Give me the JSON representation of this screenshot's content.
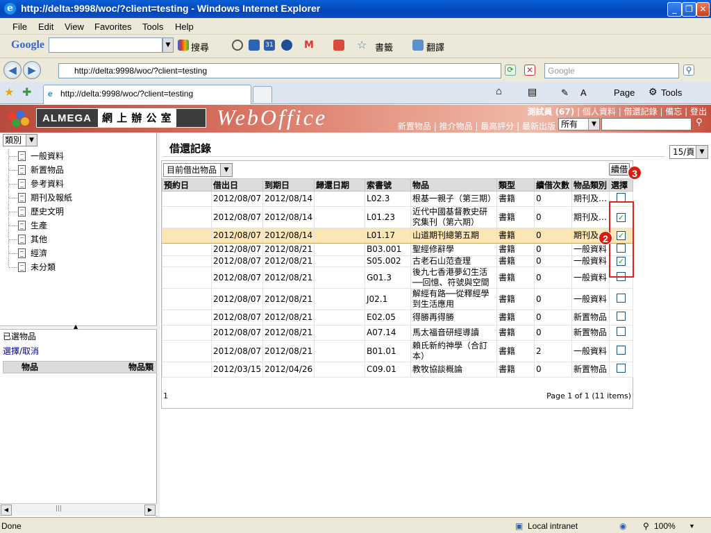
{
  "window": {
    "title": "http://delta:9998/woc/?client=testing - Windows Internet Explorer"
  },
  "menu": [
    "File",
    "Edit",
    "View",
    "Favorites",
    "Tools",
    "Help"
  ],
  "google_toolbar": {
    "brand": "Google",
    "search_label": "搜尋",
    "bookmarks_label": "書籤",
    "translate_label": "翻譯"
  },
  "address": {
    "url": "http://delta:9998/woc/?client=testing",
    "search_placeholder": "Google"
  },
  "tab": {
    "title": "http://delta:9998/woc/?client=testing"
  },
  "commandbar": {
    "page_label": "Page",
    "tools_label": "Tools"
  },
  "header": {
    "brand": "ALMEGA",
    "brand_cn": "網 上 辦 公 室",
    "logo": "WebOffice",
    "user": "測試員 (67)",
    "links_top": [
      "個人資料",
      "借還記錄",
      "備忘",
      "登出"
    ],
    "links_bottom": [
      "新置物品",
      "推介物品",
      "最高評分",
      "最新出版"
    ],
    "filter_value": "所有"
  },
  "sidebar": {
    "category_select": "類別",
    "tree": [
      "一般資料",
      "新置物品",
      "參考資料",
      "期刊及報紙",
      "歷史文明",
      "生產",
      "其他",
      "經濟",
      "未分類"
    ],
    "selected_title": "已選物品",
    "select_toggle": "選擇/取消",
    "selected_columns": [
      "物品",
      "物品類"
    ]
  },
  "main": {
    "title": "借還記錄",
    "per_page": "15/頁",
    "filter": "目前借出物品",
    "renew_button": "續借",
    "columns": [
      "預約日",
      "借出日",
      "到期日",
      "歸還日期",
      "索書號",
      "物品",
      "類型",
      "續借次數",
      "物品類別",
      "選擇"
    ],
    "rows": [
      {
        "reserve": "",
        "out": "2012/08/07",
        "due": "2012/08/14",
        "returned": "",
        "call": "L02.3",
        "item": "根基一親子（第三期）",
        "type": "書籍",
        "renew": "0",
        "category": "期刊及…",
        "checked": false
      },
      {
        "reserve": "",
        "out": "2012/08/07",
        "due": "2012/08/14",
        "returned": "",
        "call": "L01.23",
        "item": "近代中國基督教史研究集刊（第六期）",
        "type": "書籍",
        "renew": "0",
        "category": "期刊及…",
        "checked": true
      },
      {
        "reserve": "",
        "out": "2012/08/07",
        "due": "2012/08/14",
        "returned": "",
        "call": "L01.17",
        "item": "山道期刊總第五期",
        "type": "書籍",
        "renew": "0",
        "category": "期刊及…",
        "checked": true
      },
      {
        "reserve": "",
        "out": "2012/08/07",
        "due": "2012/08/21",
        "returned": "",
        "call": "B03.001",
        "item": "聖經修辭學",
        "type": "書籍",
        "renew": "0",
        "category": "一般資料",
        "checked": false
      },
      {
        "reserve": "",
        "out": "2012/08/07",
        "due": "2012/08/21",
        "returned": "",
        "call": "S05.002",
        "item": "古老石山范查理",
        "type": "書籍",
        "renew": "0",
        "category": "一般資料",
        "checked": true
      },
      {
        "reserve": "",
        "out": "2012/08/07",
        "due": "2012/08/21",
        "returned": "",
        "call": "G01.3",
        "item": "後九七香港夢幻生活──回憶、符號與空間",
        "type": "書籍",
        "renew": "0",
        "category": "一般資料",
        "checked": false
      },
      {
        "reserve": "",
        "out": "2012/08/07",
        "due": "2012/08/21",
        "returned": "",
        "call": "J02.1",
        "item": "解經有路──從釋經學到生活應用",
        "type": "書籍",
        "renew": "0",
        "category": "一般資料",
        "checked": false
      },
      {
        "reserve": "",
        "out": "2012/08/07",
        "due": "2012/08/21",
        "returned": "",
        "call": "E02.05",
        "item": "得勝再得勝",
        "type": "書籍",
        "renew": "0",
        "category": "新置物品",
        "checked": false
      },
      {
        "reserve": "",
        "out": "2012/08/07",
        "due": "2012/08/21",
        "returned": "",
        "call": "A07.14",
        "item": "馬太福音研經導讀",
        "type": "書籍",
        "renew": "0",
        "category": "新置物品",
        "checked": false
      },
      {
        "reserve": "",
        "out": "2012/08/07",
        "due": "2012/08/21",
        "returned": "",
        "call": "B01.01",
        "item": "賴氏新約神學（合訂本）",
        "type": "書籍",
        "renew": "2",
        "category": "一般資料",
        "checked": false
      },
      {
        "reserve": "",
        "out": "2012/03/15",
        "due": "2012/04/26",
        "returned": "",
        "call": "C09.01",
        "item": "教牧協談概論",
        "type": "書籍",
        "renew": "0",
        "category": "新置物品",
        "checked": false
      }
    ],
    "footer_left": "1",
    "footer_right": "Page 1 of 1 (11 items)",
    "callouts": [
      "2",
      "3"
    ]
  },
  "status": {
    "left": "Done",
    "zone": "Local intranet",
    "zoom": "100%"
  }
}
